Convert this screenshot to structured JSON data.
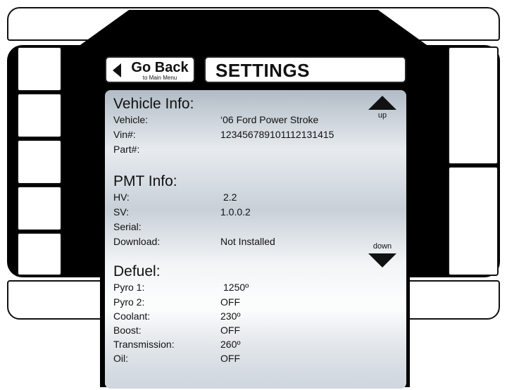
{
  "header": {
    "back_label": "Go Back",
    "back_sub": "to Main Menu",
    "title": "SETTINGS"
  },
  "scroll": {
    "up_label": "up",
    "down_label": "down"
  },
  "vehicle_info": {
    "heading": "Vehicle Info:",
    "rows": [
      {
        "label": "Vehicle:",
        "value": "‘06 Ford Power Stroke"
      },
      {
        "label": "Vin#:",
        "value": "123456789101112131415"
      },
      {
        "label": "Part#:",
        "value": ""
      }
    ]
  },
  "pmt_info": {
    "heading": "PMT Info:",
    "rows": [
      {
        "label": "HV:",
        "value": "2.2"
      },
      {
        "label": "SV:",
        "value": "1.0.0.2"
      },
      {
        "label": "Serial:",
        "value": ""
      },
      {
        "label": "Download:",
        "value": "Not Installed"
      }
    ]
  },
  "defuel": {
    "heading": "Defuel:",
    "rows": [
      {
        "label": "Pyro 1:",
        "value": "1250º"
      },
      {
        "label": "Pyro 2:",
        "value": "OFF"
      },
      {
        "label": "Coolant:",
        "value": "230º"
      },
      {
        "label": "Boost:",
        "value": "OFF"
      },
      {
        "label": "Transmission:",
        "value": "260º"
      },
      {
        "label": "Oil:",
        "value": "OFF"
      }
    ]
  },
  "colors": {
    "housing": "#000000",
    "panel_top": "#b2bcc6",
    "panel_light": "#ffffff",
    "text": "#111111"
  },
  "icons": {
    "back": "left-triangle-icon",
    "up": "up-triangle-icon",
    "down": "down-triangle-icon"
  }
}
